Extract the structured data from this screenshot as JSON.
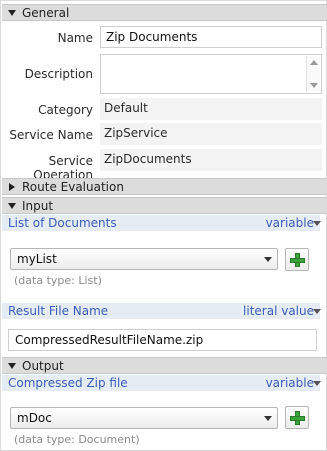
{
  "general": {
    "title": "General",
    "name_label": "Name",
    "name_value": "Zip Documents",
    "description_label": "Description",
    "description_value": "",
    "category_label": "Category",
    "category_value": "Default",
    "service_name_label": "Service Name",
    "service_name_value": "ZipService",
    "service_op_label": "Service Operation",
    "service_op_value": "ZipDocuments"
  },
  "route": {
    "title": "Route Evaluation"
  },
  "input": {
    "title": "Input",
    "list_param": "List of Documents",
    "list_kind": "variable",
    "list_value": "myList",
    "list_type": "(data type: List)",
    "result_param": "Result File Name",
    "result_kind": "literal value",
    "result_value": "CompressedResultFileName.zip"
  },
  "output": {
    "title": "Output",
    "zip_param": "Compressed Zip file",
    "zip_kind": "variable",
    "zip_value": "mDoc",
    "zip_type": "(data type: Document)"
  }
}
